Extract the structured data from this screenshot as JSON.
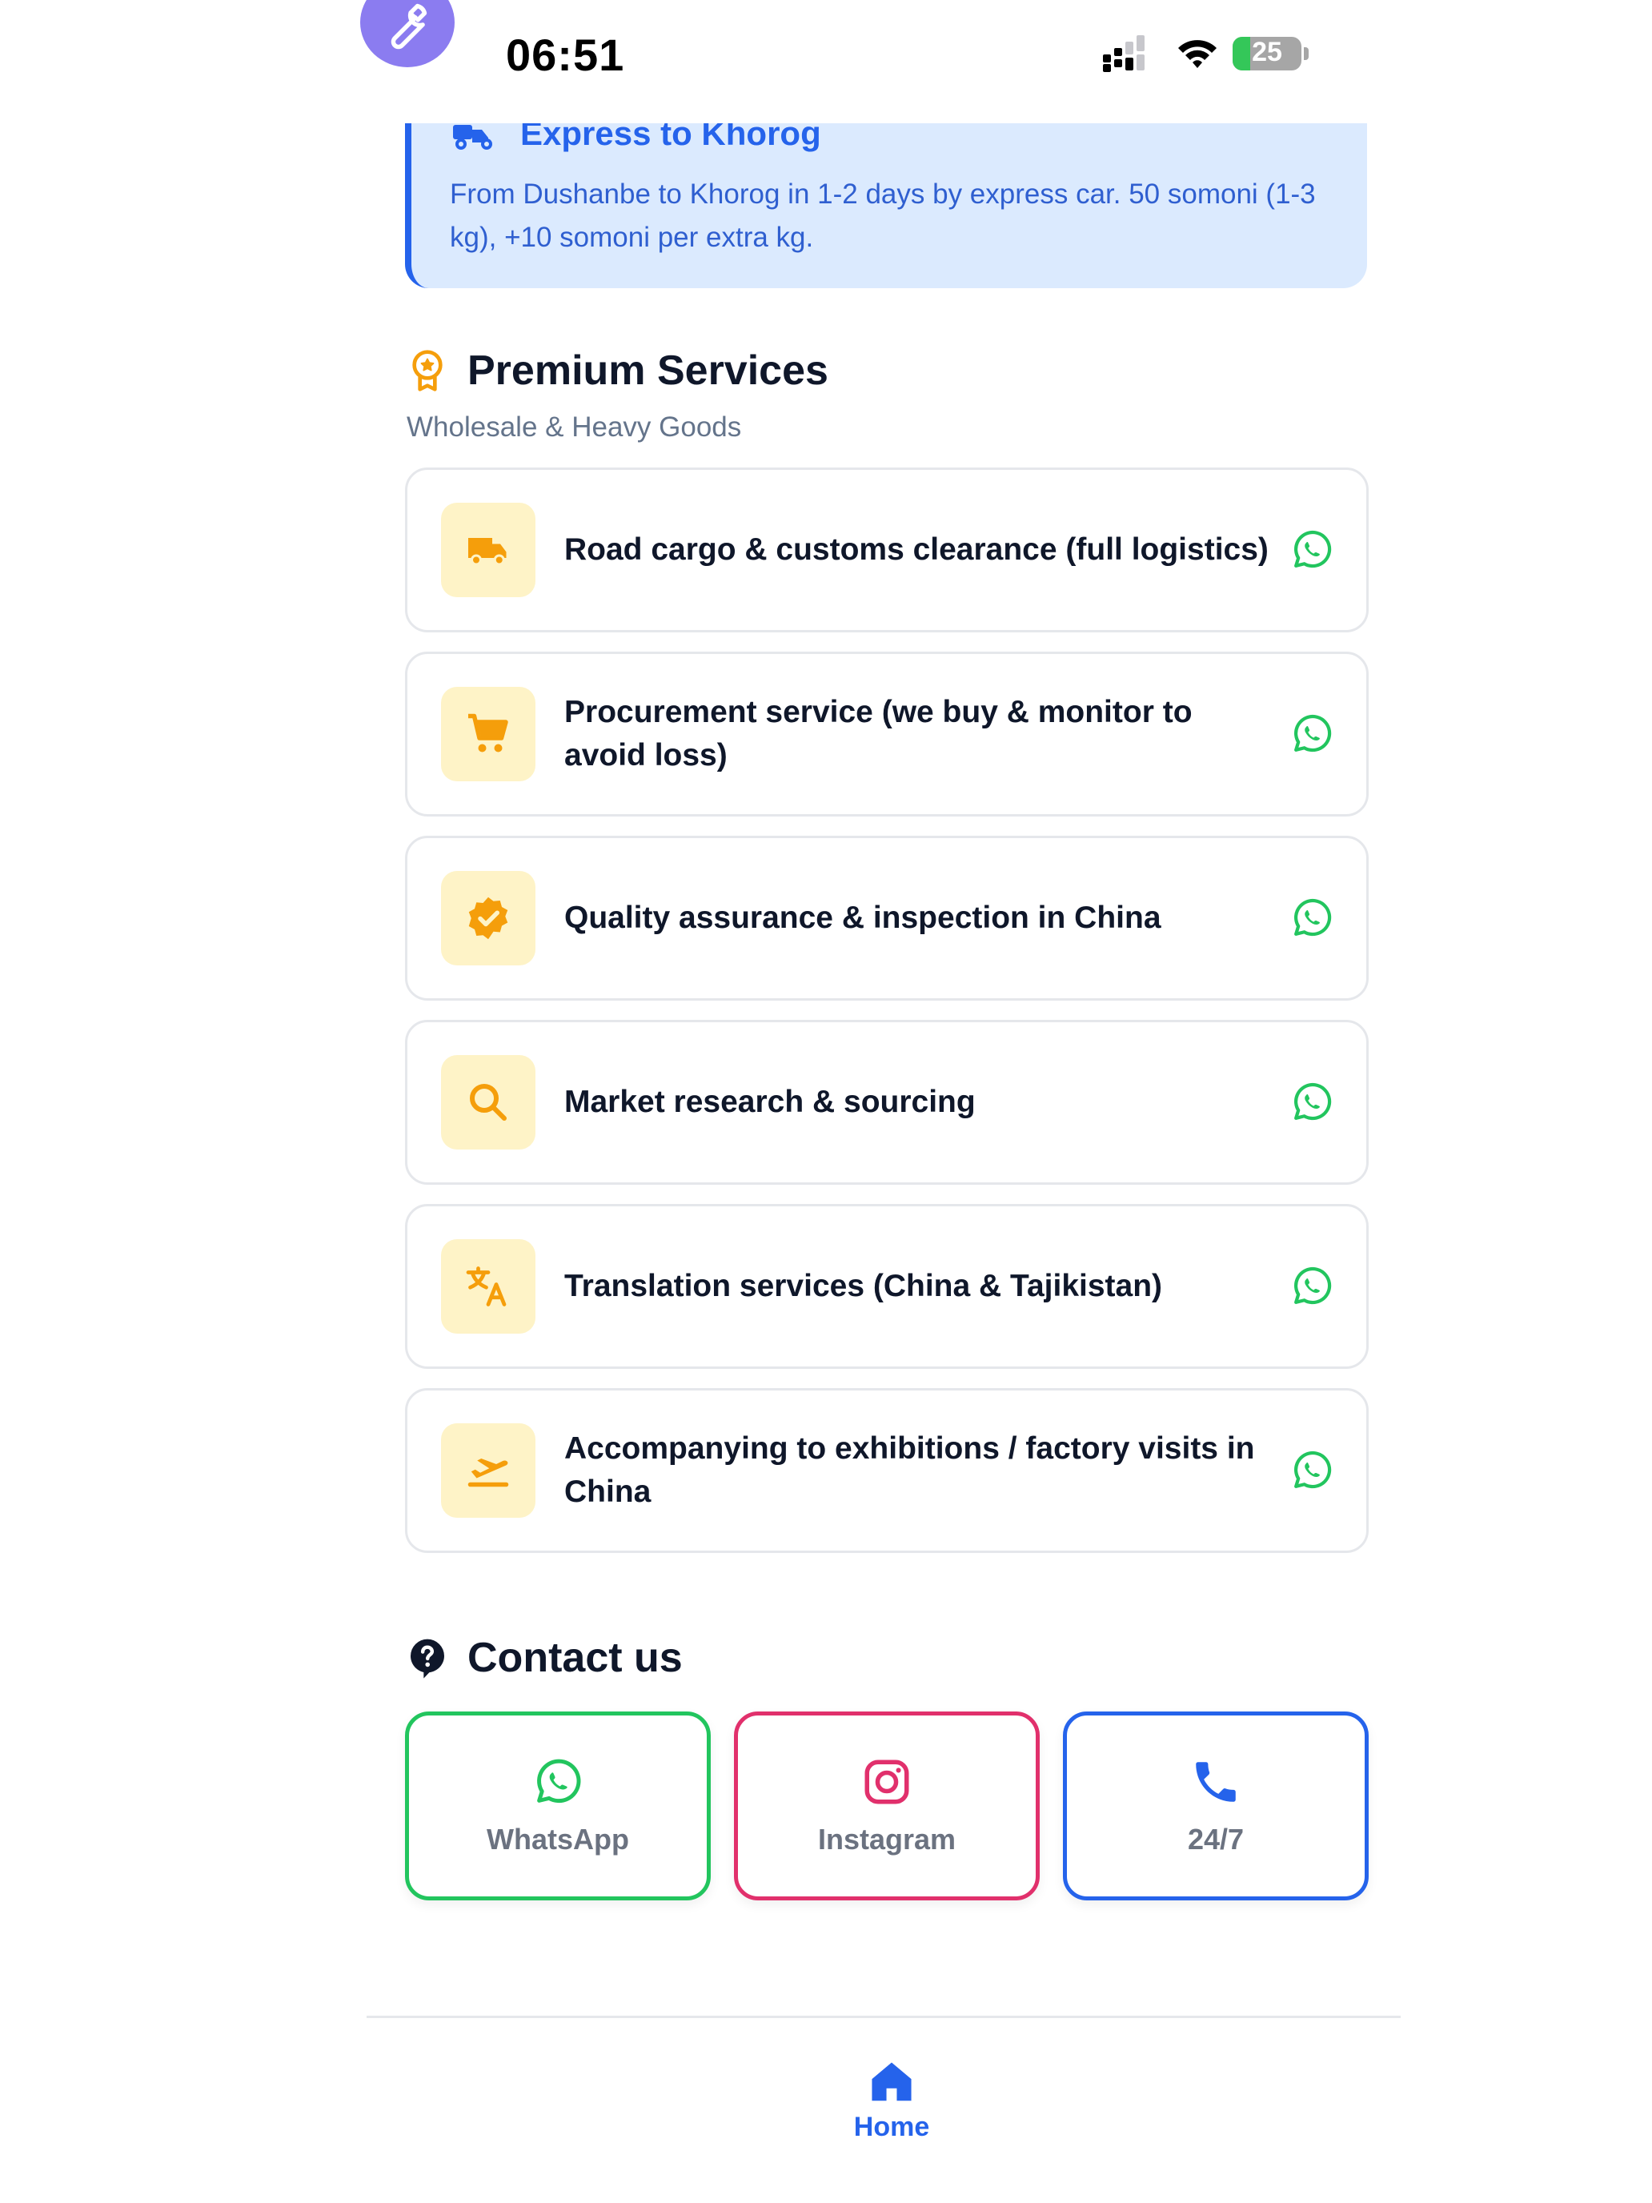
{
  "status_bar": {
    "time": "06:51",
    "battery_percent": 25,
    "battery_label": "25"
  },
  "express": {
    "title": "Express to Khorog",
    "description": "From Dushanbe to Khorog in 1-2 days by express car. 50 somoni (1-3 kg), +10 somoni per extra kg."
  },
  "premium": {
    "title": "Premium Services",
    "subtitle": "Wholesale & Heavy Goods",
    "items": [
      {
        "label": "Road cargo & customs clearance (full logistics)",
        "icon": "truck-icon"
      },
      {
        "label": "Procurement service (we buy & monitor to avoid loss)",
        "icon": "cart-icon"
      },
      {
        "label": "Quality assurance & inspection in China",
        "icon": "verified-badge-icon"
      },
      {
        "label": "Market research & sourcing",
        "icon": "search-icon"
      },
      {
        "label": "Translation services (China & Tajikistan)",
        "icon": "translate-icon"
      },
      {
        "label": "Accompanying to exhibitions / factory visits in China",
        "icon": "flight-takeoff-icon"
      }
    ]
  },
  "contact": {
    "title": "Contact us",
    "whatsapp": "WhatsApp",
    "instagram": "Instagram",
    "phone": "24/7"
  },
  "nav": {
    "home": "Home"
  },
  "colors": {
    "primary": "#2563eb",
    "amber": "#f59e0b",
    "amber_bg": "#fef3c7",
    "whatsapp": "#22c55e",
    "instagram": "#e1306c",
    "express_bg": "#dbeafe"
  }
}
